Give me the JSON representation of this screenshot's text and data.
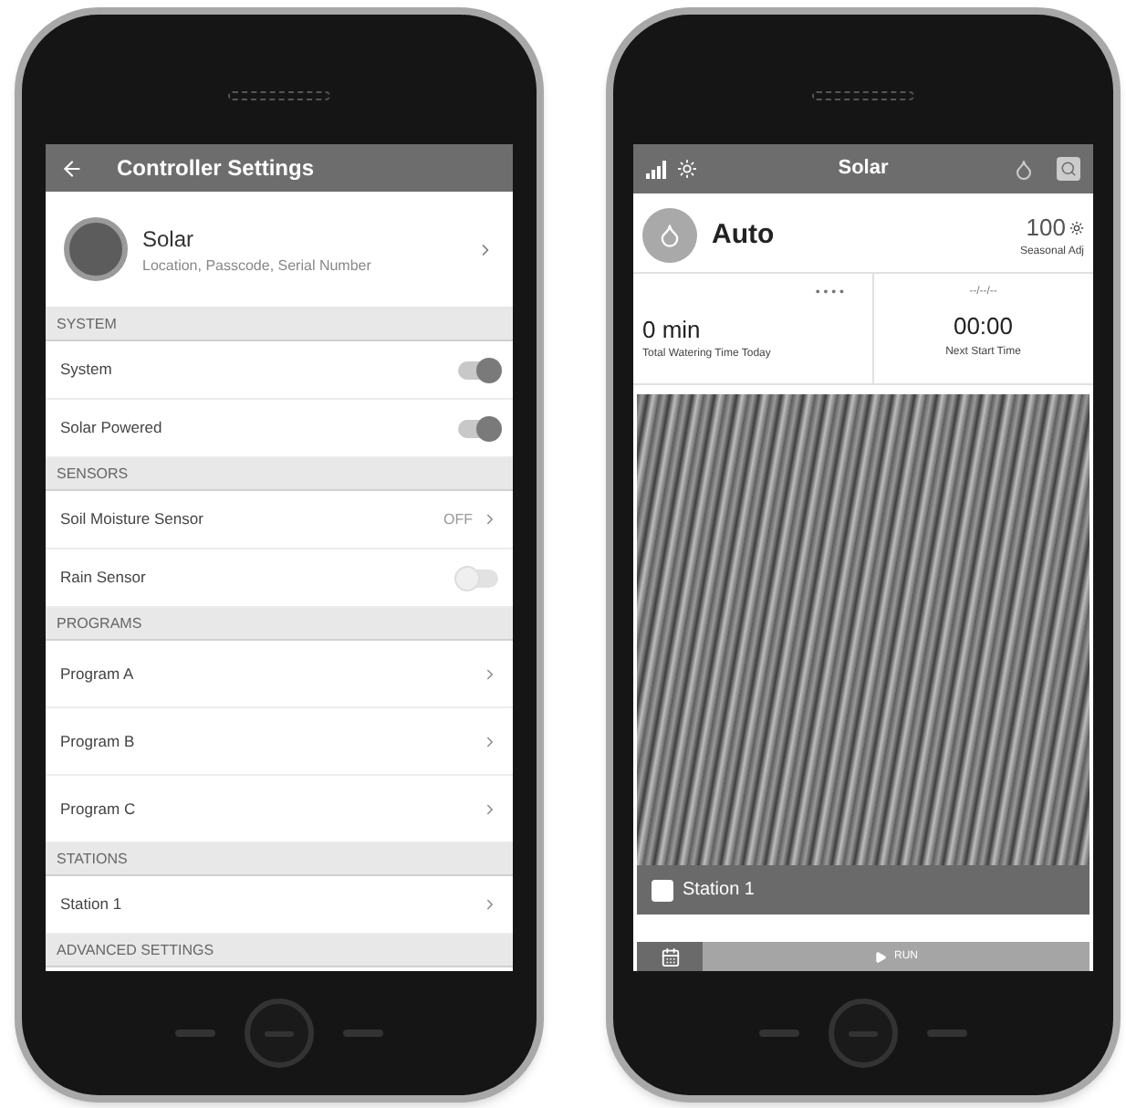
{
  "settings_screen": {
    "title": "Controller Settings",
    "controller": {
      "name": "Solar",
      "subtitle": "Location, Passcode, Serial Number"
    },
    "sections": [
      {
        "header": "SYSTEM",
        "items": [
          {
            "kind": "toggle",
            "label": "System",
            "on": true
          },
          {
            "kind": "toggle",
            "label": "Solar Powered",
            "on": true
          }
        ]
      },
      {
        "header": "SENSORS",
        "items": [
          {
            "kind": "link",
            "label": "Soil Moisture Sensor",
            "value": "OFF"
          },
          {
            "kind": "toggle",
            "label": "Rain Sensor",
            "on": false
          }
        ]
      },
      {
        "header": "PROGRAMS",
        "items": [
          {
            "kind": "link",
            "label": "Program A"
          },
          {
            "kind": "link",
            "label": "Program B"
          },
          {
            "kind": "link",
            "label": "Program C"
          }
        ]
      },
      {
        "header": "STATIONS",
        "items": [
          {
            "kind": "link",
            "label": "Station 1"
          }
        ]
      },
      {
        "header": "ADVANCED SETTINGS"
      }
    ]
  },
  "home_screen": {
    "title": "Solar",
    "mode": "Auto",
    "seasonal": {
      "value": "100",
      "label": "Seasonal Adj"
    },
    "watering": {
      "dots": "• • • •",
      "value": "0 min",
      "label": "Total Watering Time Today"
    },
    "next_start": {
      "date": "--/--/--",
      "value": "00:00",
      "label": "Next Start Time"
    },
    "station": {
      "label": "Station 1",
      "checked": false
    },
    "run_button": {
      "label": "RUN"
    }
  }
}
